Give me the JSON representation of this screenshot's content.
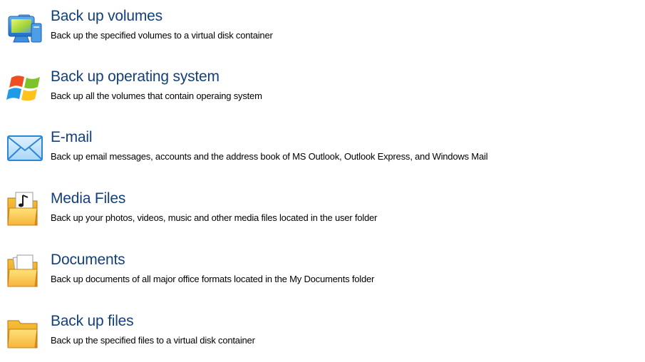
{
  "items": [
    {
      "title": "Back up volumes",
      "description": "Back up the specified volumes to a virtual disk container",
      "icon": "computer-icon"
    },
    {
      "title": "Back up operating system",
      "description": "Back up all the volumes that contain operaing system",
      "icon": "windows-logo-icon"
    },
    {
      "title": "E-mail",
      "description": "Back up email messages, accounts and the address book of MS Outlook, Outlook Express, and Windows Mail",
      "icon": "envelope-icon"
    },
    {
      "title": "Media Files",
      "description": "Back up your photos, videos, music and other media files located in the user folder",
      "icon": "media-folder-icon"
    },
    {
      "title": "Documents",
      "description": "Back up documents of all major office formats located in the My Documents folder",
      "icon": "documents-folder-icon"
    },
    {
      "title": "Back up files",
      "description": "Back up the specified files to a virtual disk container",
      "icon": "folder-icon"
    }
  ]
}
